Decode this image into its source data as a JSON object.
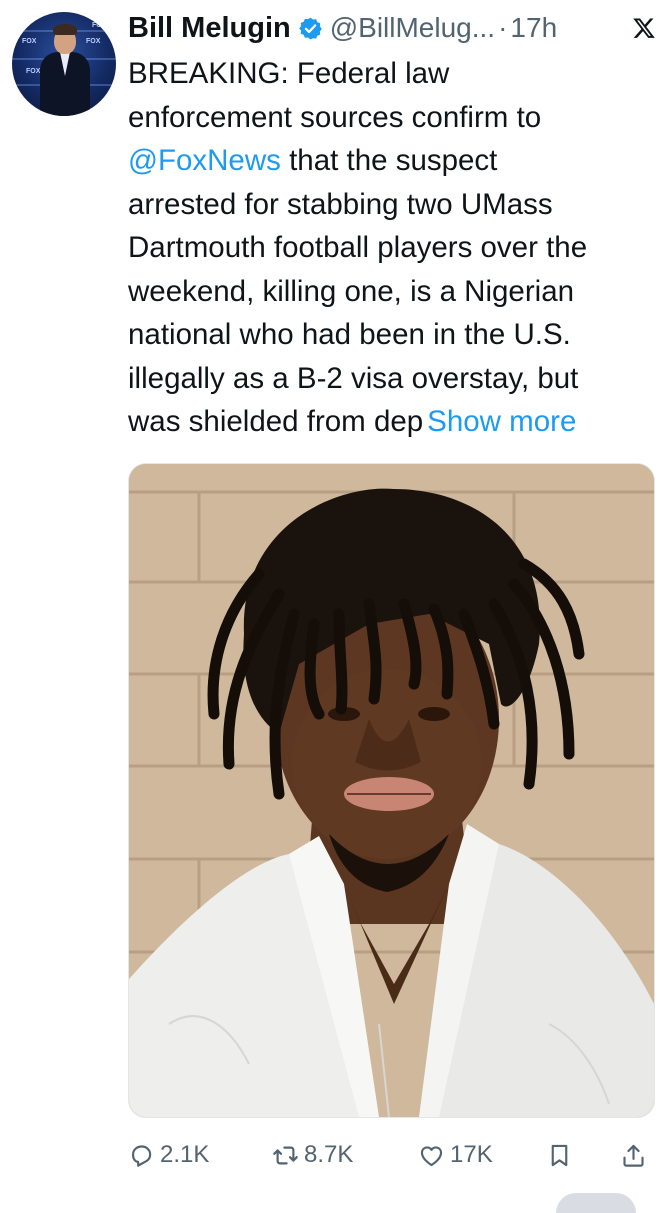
{
  "author": {
    "name": "Bill Melugin",
    "handle": "@BillMelug...",
    "separator": "·",
    "time": "17h",
    "avatar_marks": [
      "FOX",
      "FOX",
      "FOX",
      "FOX"
    ]
  },
  "tweet": {
    "lines": [
      "BREAKING: Federal law",
      "enforcement sources confirm to",
      "that the suspect",
      "arrested for stabbing two UMass",
      "Dartmouth football players over the",
      "weekend, killing one, is a Nigerian",
      "national who had been in the U.S.",
      "illegally as a B-2 visa overstay, but",
      "was shielded from dep"
    ],
    "mention": "@FoxNews",
    "show_more": "Show more"
  },
  "actions": {
    "replies": "2.1K",
    "reposts": "8.7K",
    "likes": "17K"
  },
  "icons": {
    "verified": "verified-badge-icon",
    "x_logo": "x-logo-icon",
    "reply": "reply-icon",
    "repost": "repost-icon",
    "like": "heart-icon",
    "bookmark": "bookmark-icon",
    "share": "share-icon"
  },
  "colors": {
    "link": "#1d9bf0",
    "text": "#0f1419",
    "muted": "#536471"
  }
}
